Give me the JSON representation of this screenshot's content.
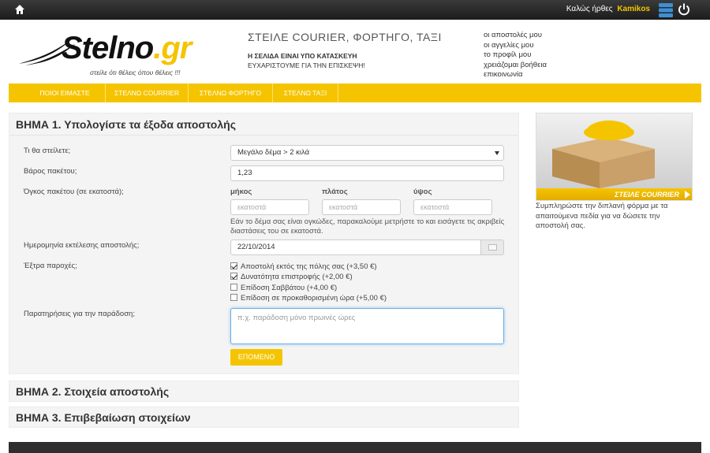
{
  "topbar": {
    "welcome_prefix": "Καλώς ήρθες",
    "username": "Kamikos",
    "icons": [
      "home-icon",
      "database-icon",
      "power-icon"
    ]
  },
  "header": {
    "logo_main": "Stelno",
    "logo_suffix": ".gr",
    "logo_tagline": "στείλε ότι θέλεις όπου θέλεις !!!",
    "title": "ΣΤΕΙΛΕ COURIER, ΦΟΡΤΗΓΟ, ΤΑΞΙ",
    "notice_line1": "Η ΣΕΛΙΔΑ ΕΙΝΑΙ ΥΠΟ ΚΑΤΑΣΚΕΥΗ",
    "notice_line2": "ΕΥΧΑΡΙΣΤΟΥΜΕ ΓΙΑ ΤΗΝ ΕΠΙΣΚΕΨΗ!",
    "user_menu": [
      "οι αποστολές μου",
      "οι αγγελίες μου",
      "το προφίλ μου",
      "χρειάζομαι βοήθεια",
      "επικοινωνία"
    ]
  },
  "nav": {
    "items": [
      "ΠΟΙΟΙ ΕΙΜΑΣΤΕ",
      "ΣΤΕΛΝΩ COURRIER",
      "ΣΤΕΛΝΩ ΦΟΡΤΗΓΟ",
      "ΣΤΕΛΝΩ ΤΑΞΙ"
    ]
  },
  "step1": {
    "title": "ΒΗΜΑ 1. Υπολογίστε τα έξοδα αποστολής",
    "what_label": "Τι θα στείλετε;",
    "what_value": "Μεγάλο δέμα > 2 κιλά",
    "weight_label": "Βάρος πακέτου;",
    "weight_value": "1,23",
    "volume_label": "Όγκος πακέτου (σε εκατοστά);",
    "dim_length": "μήκος",
    "dim_width": "πλάτος",
    "dim_height": "ύψος",
    "dim_placeholder": "εκατοστά",
    "hint": "Εάν το δέμα σας είναι ογκώδες, παρακαλούμε μετρήστε το και εισάγετε τις ακριβείς διαστάσεις του σε εκατοστά.",
    "date_label": "Ημερομηνία εκτέλεσης αποστολής;",
    "date_value": "22/10/2014",
    "extras_label": "Έξτρα παροχές;",
    "extras": [
      {
        "label": "Αποστολή εκτός της πόλης σας (+3,50 €)",
        "checked": true
      },
      {
        "label": "Δυνατότητα επιστροφής (+2,00 €)",
        "checked": true
      },
      {
        "label": "Επίδοση Σαββάτου (+4,00 €)",
        "checked": false
      },
      {
        "label": "Επίδοση σε προκαθορισμένη ώρα (+5,00 €)",
        "checked": false
      }
    ],
    "notes_label": "Παρατηρήσεις για την παράδοση;",
    "notes_placeholder": "π.χ. παράδοση μόνο πρωινές ώρες",
    "next_label": "ΕΠΟΜΕΝΟ"
  },
  "step2": {
    "title": "ΒΗΜΑ 2. Στοιχεία αποστολής"
  },
  "step3": {
    "title": "ΒΗΜΑ 3. Επιβεβαίωση στοιχείων"
  },
  "sidebar": {
    "banner_label": "ΣΤΕΙΛΕ COURRIER",
    "text": "Συμπληρώστε την διπλανή φόρμα με τα απαιτούμενα πεδία για να δώσετε την αποστολή σας."
  },
  "colors": {
    "accent": "#f5c400",
    "topbar": "#2a2a2a",
    "panel": "#f4f4f4"
  }
}
